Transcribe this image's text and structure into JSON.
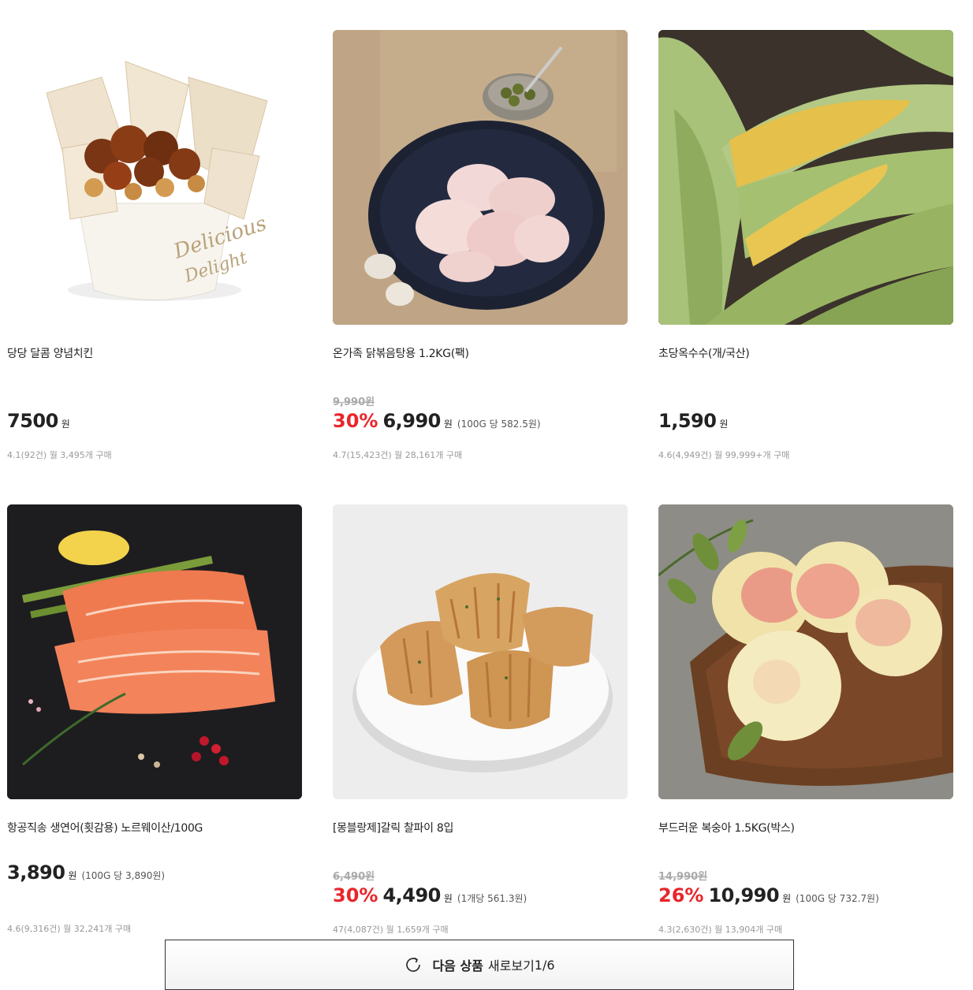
{
  "products": [
    {
      "name": "당당 달콤 양념치킨",
      "original_price": "",
      "discount": "",
      "price": "7500",
      "currency": "원",
      "unit_price": "",
      "meta": "4.1(92건) 월 3,495개 구매",
      "image": "chicken-bucket-image"
    },
    {
      "name": "온가족 닭볶음탕용 1.2KG(팩)",
      "original_price": "9,990원",
      "discount": "30%",
      "price": "6,990",
      "currency": "원",
      "unit_price": "(100G 당 582.5원)",
      "meta": "4.7(15,423건) 월 28,161개 구매",
      "image": "raw-chicken-bowl-image"
    },
    {
      "name": "초당옥수수(개/국산)",
      "original_price": "",
      "discount": "",
      "price": "1,590",
      "currency": "원",
      "unit_price": "",
      "meta": "4.6(4,949건) 월 99,999+개 구매",
      "image": "corn-image"
    },
    {
      "name": "항공직송 생연어(횟감용) 노르웨이산/100G",
      "original_price": "",
      "discount": "",
      "price": "3,890",
      "currency": "원",
      "unit_price": "(100G 당 3,890원)",
      "meta": "4.6(9,316건) 월 32,241개 구매",
      "image": "salmon-image"
    },
    {
      "name": "[몽블랑제]갈릭 찰파이 8입",
      "original_price": "6,490원",
      "discount": "30%",
      "price": "4,490",
      "currency": "원",
      "unit_price": "(1개당 561.3원)",
      "meta": "47(4,087건) 월 1,659개 구매",
      "image": "garlic-pie-image"
    },
    {
      "name": "부드러운 복숭아 1.5KG(박스)",
      "original_price": "14,990원",
      "discount": "26%",
      "price": "10,990",
      "currency": "원",
      "unit_price": "(100G 당 732.7원)",
      "meta": "4.3(2,630건) 월 13,904개 구매",
      "image": "peach-image"
    }
  ],
  "more_button": {
    "bold_label": "다음 상품",
    "label": "새로보기",
    "page": "1/6",
    "icon": "refresh-icon"
  },
  "colors": {
    "discount": "#e8262b",
    "meta": "#999999"
  }
}
